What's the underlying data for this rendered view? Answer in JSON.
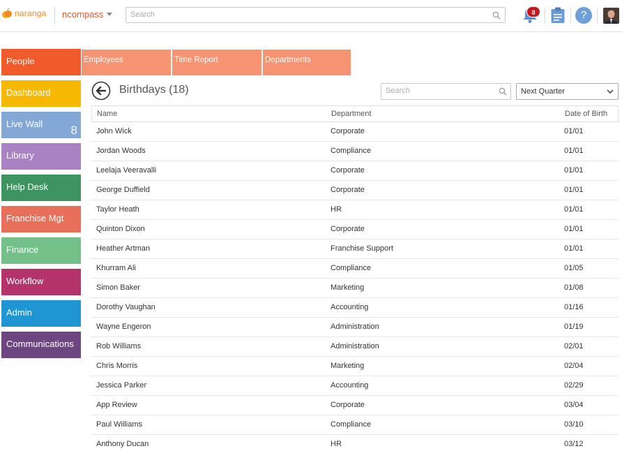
{
  "header": {
    "logo_text": "naranga",
    "app_name": "ncompass",
    "search_placeholder": "Search",
    "notification_count": "8",
    "help_label": "?"
  },
  "nav": {
    "items": [
      {
        "label": "People",
        "color": "#f15a2a"
      },
      {
        "label": "Dashboard",
        "color": "#f6b800"
      },
      {
        "label": "Live Wall",
        "color": "#84a8d6",
        "count": "8"
      },
      {
        "label": "Library",
        "color": "#a982c4"
      },
      {
        "label": "Help Desk",
        "color": "#3e9460"
      },
      {
        "label": "Franchise Mgt",
        "color": "#e8705a"
      },
      {
        "label": "Finance",
        "color": "#73c189"
      },
      {
        "label": "Workflow",
        "color": "#b5336b"
      },
      {
        "label": "Admin",
        "color": "#1f95d4"
      },
      {
        "label": "Communications",
        "color": "#6d4580"
      }
    ]
  },
  "tabs": [
    {
      "label": "Employees"
    },
    {
      "label": "Time Report"
    },
    {
      "label": "Departments"
    }
  ],
  "content": {
    "title": "Birthdays (18)",
    "search_placeholder": "Search",
    "period": "Next Quarter"
  },
  "table": {
    "headers": {
      "name": "Name",
      "department": "Department",
      "dob": "Date of Birth"
    },
    "rows": [
      {
        "name": "John Wick",
        "department": "Corporate",
        "dob": "01/01"
      },
      {
        "name": "Jordan Woods",
        "department": "Compliance",
        "dob": "01/01"
      },
      {
        "name": "Leelaja Veeravalli",
        "department": "Corporate",
        "dob": "01/01"
      },
      {
        "name": "George Duffield",
        "department": "Corporate",
        "dob": "01/01"
      },
      {
        "name": "Taylor Heath",
        "department": "HR",
        "dob": "01/01"
      },
      {
        "name": "Quinton Dixon",
        "department": "Corporate",
        "dob": "01/01"
      },
      {
        "name": "Heather Artman",
        "department": "Franchise Support",
        "dob": "01/01"
      },
      {
        "name": "Khurram Ali",
        "department": "Compliance",
        "dob": "01/05"
      },
      {
        "name": "Simon Baker",
        "department": "Marketing",
        "dob": "01/08"
      },
      {
        "name": "Dorothy Vaughan",
        "department": "Accounting",
        "dob": "01/16"
      },
      {
        "name": "Wayne Engeron",
        "department": "Administration",
        "dob": "01/19"
      },
      {
        "name": "Rob Williams",
        "department": "Administration",
        "dob": "02/01"
      },
      {
        "name": "Chris Morris",
        "department": "Marketing",
        "dob": "02/04"
      },
      {
        "name": "Jessica Parker",
        "department": "Accounting",
        "dob": "02/29"
      },
      {
        "name": "App Review",
        "department": "Corporate",
        "dob": "03/04"
      },
      {
        "name": "Paul Williams",
        "department": "Compliance",
        "dob": "03/10"
      },
      {
        "name": "Anthony Ducan",
        "department": "HR",
        "dob": "03/12"
      }
    ]
  }
}
